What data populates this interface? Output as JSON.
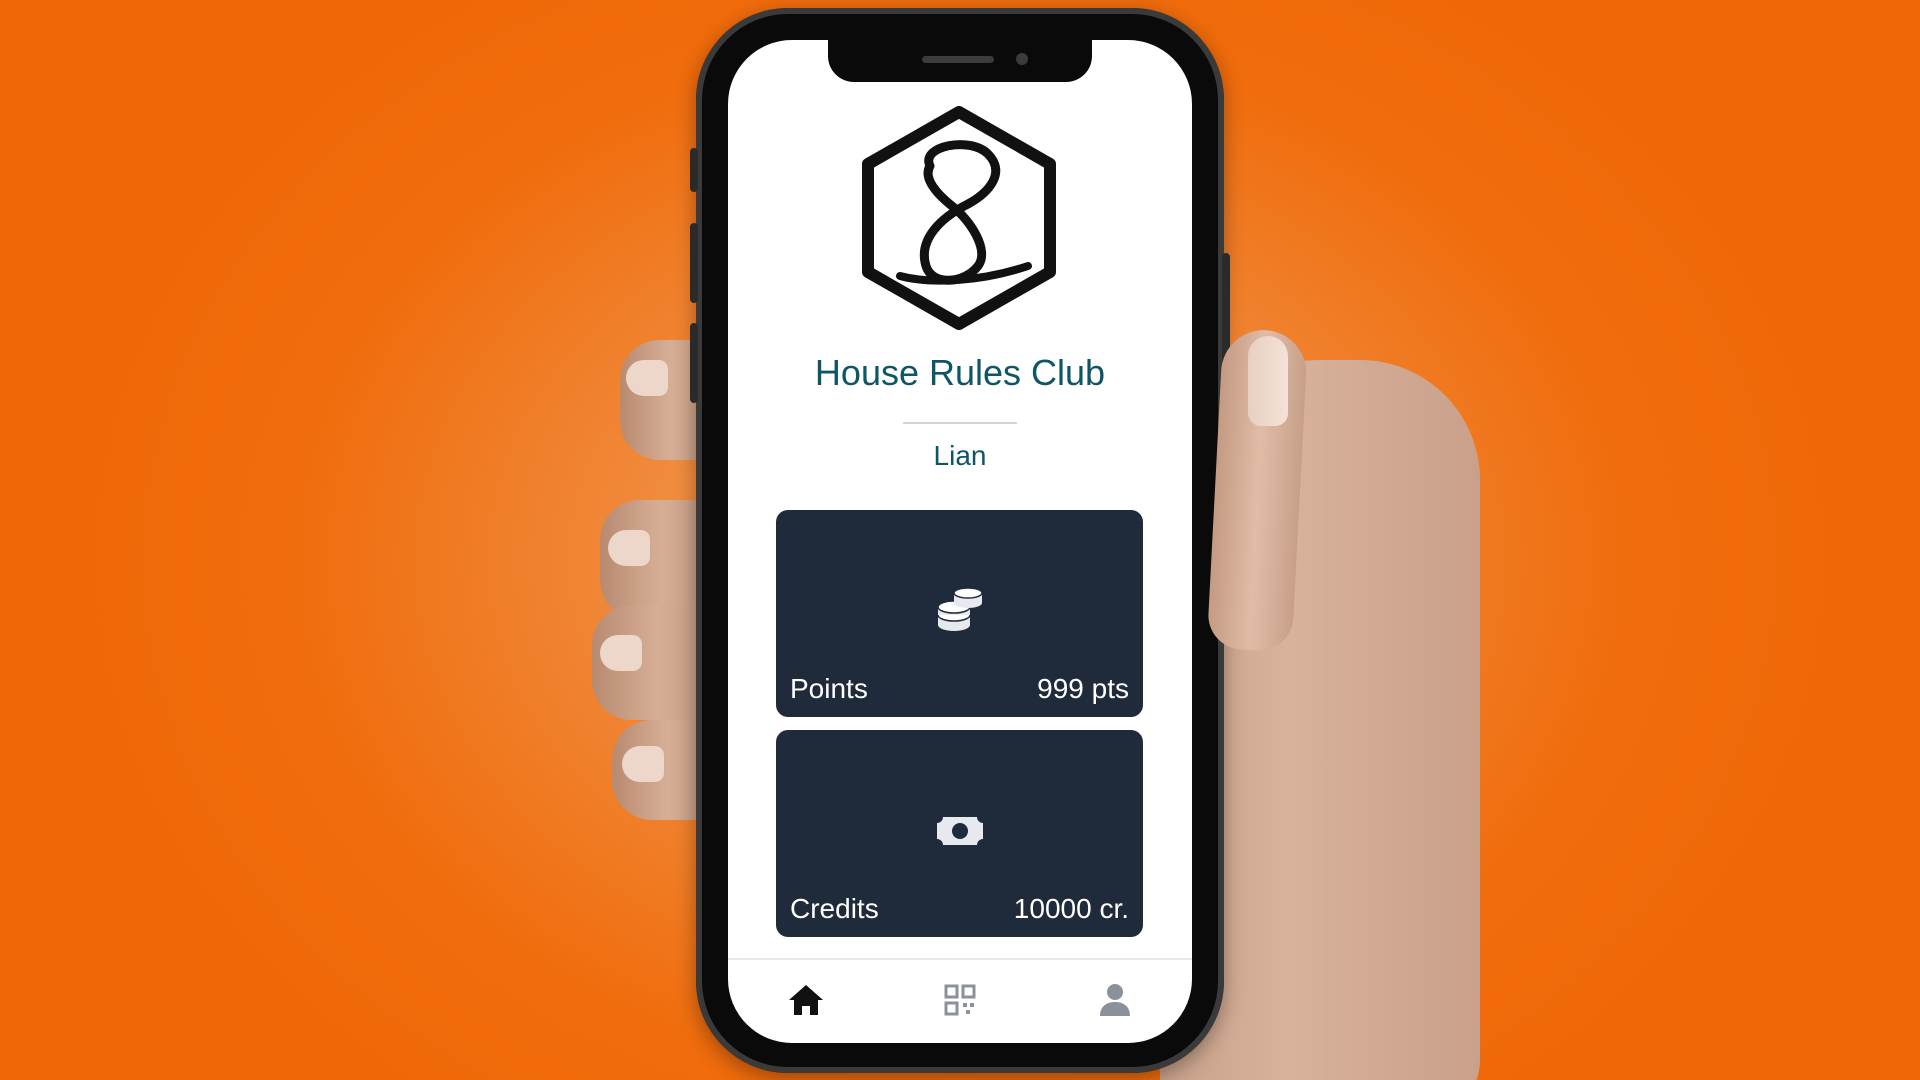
{
  "app": {
    "club_name": "House Rules Club",
    "user_name": "Lian",
    "logo_icon": "hexagon-eight-logo"
  },
  "cards": {
    "points": {
      "icon": "coins-icon",
      "label": "Points",
      "value": "999 pts"
    },
    "credits": {
      "icon": "money-bill-icon",
      "label": "Credits",
      "value": "10000 cr."
    }
  },
  "nav": {
    "items": [
      {
        "icon": "home-icon",
        "active": true
      },
      {
        "icon": "qr-code-icon",
        "active": false
      },
      {
        "icon": "user-icon",
        "active": false
      }
    ]
  },
  "colors": {
    "background": "#f06c0c",
    "title_text": "#0e5566",
    "card_bg": "#1f2a3a",
    "nav_active": "#111111",
    "nav_inactive": "#8a919a"
  }
}
